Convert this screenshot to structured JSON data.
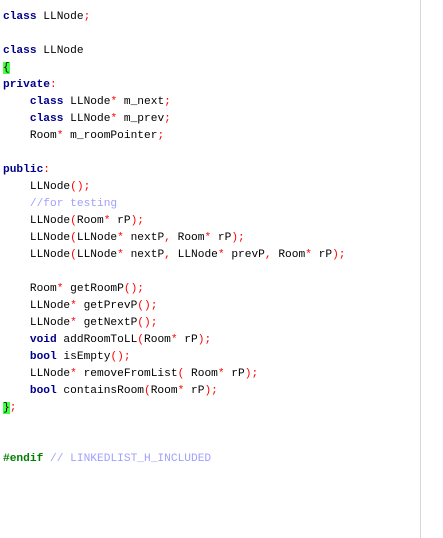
{
  "editor": {
    "lines": [
      [
        [
          "kw",
          "class"
        ],
        [
          "t",
          " LLNode"
        ],
        [
          "op",
          ";"
        ]
      ],
      [],
      [
        [
          "kw",
          "class"
        ],
        [
          "t",
          " LLNode"
        ]
      ],
      [
        [
          "hl",
          "{"
        ]
      ],
      [
        [
          "kw",
          "private"
        ],
        [
          "op",
          ":"
        ]
      ],
      [
        [
          "t",
          "    "
        ],
        [
          "kw",
          "class"
        ],
        [
          "t",
          " LLNode"
        ],
        [
          "op",
          "*"
        ],
        [
          "t",
          " m_next"
        ],
        [
          "op",
          ";"
        ]
      ],
      [
        [
          "t",
          "    "
        ],
        [
          "kw",
          "class"
        ],
        [
          "t",
          " LLNode"
        ],
        [
          "op",
          "*"
        ],
        [
          "t",
          " m_prev"
        ],
        [
          "op",
          ";"
        ]
      ],
      [
        [
          "t",
          "    Room"
        ],
        [
          "op",
          "*"
        ],
        [
          "t",
          " m_roomPointer"
        ],
        [
          "op",
          ";"
        ]
      ],
      [],
      [
        [
          "kw",
          "public"
        ],
        [
          "op",
          ":"
        ]
      ],
      [
        [
          "t",
          "    LLNode"
        ],
        [
          "op",
          "();"
        ]
      ],
      [
        [
          "t",
          "    "
        ],
        [
          "cm",
          "//for testing"
        ]
      ],
      [
        [
          "t",
          "    LLNode"
        ],
        [
          "op",
          "("
        ],
        [
          "t",
          "Room"
        ],
        [
          "op",
          "*"
        ],
        [
          "t",
          " rP"
        ],
        [
          "op",
          ");"
        ]
      ],
      [
        [
          "t",
          "    LLNode"
        ],
        [
          "op",
          "("
        ],
        [
          "t",
          "LLNode"
        ],
        [
          "op",
          "*"
        ],
        [
          "t",
          " nextP"
        ],
        [
          "op",
          ","
        ],
        [
          "t",
          " Room"
        ],
        [
          "op",
          "*"
        ],
        [
          "t",
          " rP"
        ],
        [
          "op",
          ");"
        ]
      ],
      [
        [
          "t",
          "    LLNode"
        ],
        [
          "op",
          "("
        ],
        [
          "t",
          "LLNode"
        ],
        [
          "op",
          "*"
        ],
        [
          "t",
          " nextP"
        ],
        [
          "op",
          ","
        ],
        [
          "t",
          " LLNode"
        ],
        [
          "op",
          "*"
        ],
        [
          "t",
          " prevP"
        ],
        [
          "op",
          ","
        ],
        [
          "t",
          " Room"
        ],
        [
          "op",
          "*"
        ],
        [
          "t",
          " rP"
        ],
        [
          "op",
          ");"
        ]
      ],
      [],
      [
        [
          "t",
          "    Room"
        ],
        [
          "op",
          "*"
        ],
        [
          "t",
          " getRoomP"
        ],
        [
          "op",
          "();"
        ]
      ],
      [
        [
          "t",
          "    LLNode"
        ],
        [
          "op",
          "*"
        ],
        [
          "t",
          " getPrevP"
        ],
        [
          "op",
          "();"
        ]
      ],
      [
        [
          "t",
          "    LLNode"
        ],
        [
          "op",
          "*"
        ],
        [
          "t",
          " getNextP"
        ],
        [
          "op",
          "();"
        ]
      ],
      [
        [
          "t",
          "    "
        ],
        [
          "kw",
          "void"
        ],
        [
          "t",
          " addRoomToLL"
        ],
        [
          "op",
          "("
        ],
        [
          "t",
          "Room"
        ],
        [
          "op",
          "*"
        ],
        [
          "t",
          " rP"
        ],
        [
          "op",
          ");"
        ]
      ],
      [
        [
          "t",
          "    "
        ],
        [
          "kw",
          "bool"
        ],
        [
          "t",
          " isEmpty"
        ],
        [
          "op",
          "();"
        ]
      ],
      [
        [
          "t",
          "    LLNode"
        ],
        [
          "op",
          "*"
        ],
        [
          "t",
          " removeFromList"
        ],
        [
          "op",
          "("
        ],
        [
          "t",
          " Room"
        ],
        [
          "op",
          "*"
        ],
        [
          "t",
          " rP"
        ],
        [
          "op",
          ");"
        ]
      ],
      [
        [
          "t",
          "    "
        ],
        [
          "kw",
          "bool"
        ],
        [
          "t",
          " containsRoom"
        ],
        [
          "op",
          "("
        ],
        [
          "t",
          "Room"
        ],
        [
          "op",
          "*"
        ],
        [
          "t",
          " rP"
        ],
        [
          "op",
          ");"
        ]
      ],
      [
        [
          "hl",
          "}"
        ],
        [
          "op",
          ";"
        ]
      ],
      [],
      [],
      [
        [
          "pp",
          "#endif"
        ],
        [
          "t",
          " "
        ],
        [
          "cm",
          "// LINKEDLIST_H_INCLUDED"
        ]
      ]
    ]
  }
}
